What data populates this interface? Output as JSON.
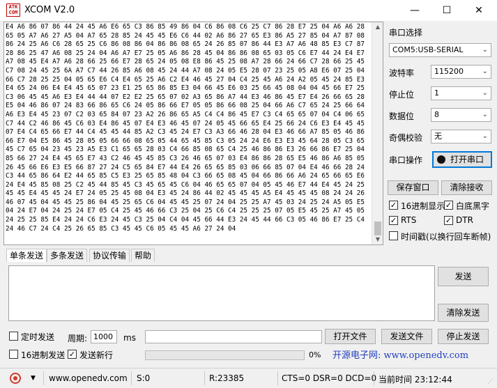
{
  "window": {
    "logo_text": "ATK COM",
    "title": "XCOM V2.0",
    "minimize": "—",
    "maximize": "☐",
    "close": "✕"
  },
  "receive": {
    "text": "E4 A6 86 07 86 44 24 45 A6 E6 65 C3 86 85 49 86 04 C6 86 08 C6 25 C7 86 28 E7 25 04 A6 A6 28 65 05 A7 A6 27 A5 04 A7 65 28 85 24 45 45 E6 C6 44 02 A6 86 27 65 E3 86 A5 27 85 04 A7 87 08 86 24 25 A6 C6 28 65 25 C6 86 08 86 04 86 86 08 65 24 26 85 07 86 44 E3 A7 A6 48 85 E3 C7 87 28 86 25 47 A6 08 25 24 04 A6 A7 E7 25 05 A6 86 28 45 04 86 86 08 65 03 05 C6 E7 44 24 E4 E7 A7 08 45 E4 A7 A6 28 66 25 66 E7 28 65 24 05 08 E8 86 45 25 08 A7 28 66 24 66 C7 28 66 25 45 C7 08 24 45 25 6A A7 C7 44 26 85 A6 08 45 24 44 A7 08 24 05 E5 28 07 23 25 05 A8 E6 07 25 04 66 C7 28 25 25 04 05 65 E6 C4 E4 65 25 A6 C2 E4 46 45 27 04 C4 25 45 A6 24 A2 05 45 24 85 E3 E4 65 24 06 E4 E4 45 65 07 23 E1 25 65 86 85 E3 04 66 45 E6 03 25 66 45 08 04 04 45 66 E7 25 C3 06 45 45 A6 E3 E4 44 44 07 E2 E2 25 65 07 02 A3 65 86 A7 44 E3 46 86 45 E7 E4 26 66 65 28 E5 04 46 86 07 24 83 66 86 65 C6 24 05 86 66 E7 05 05 86 66 08 25 04 66 A6 C7 65 24 25 66 64 A6 E3 E4 45 23 07 C2 03 65 84 07 23 A2 26 86 65 A5 C4 C4 86 45 E7 C3 C4 65 65 07 04 C4 06 65 C7 44 C2 46 86 45 C6 03 E4 86 45 07 E4 E3 46 45 07 24 05 45 66 65 E4 25 66 24 C6 E3 E4 45 45 07 E4 C4 65 66 E7 44 C4 45 45 44 85 A2 C3 45 24 E7 C3 A3 66 46 28 04 E3 46 66 A7 85 05 46 86 66 E7 04 E5 86 45 28 05 05 66 66 08 65 05 44 65 45 85 C3 05 24 24 E6 E3 E3 45 64 28 05 C3 65 45 C7 65 04 23 45 23 A5 E3 C1 65 65 28 03 C4 66 85 08 65 C4 25 46 86 86 E3 26 66 86 E7 25 04 85 66 27 24 E4 45 65 E7 43 C2 46 45 45 85 C3 26 46 65 07 03 E4 86 86 28 65 E5 46 86 A6 85 05 26 45 66 E6 E3 E5 66 87 27 24 C5 65 84 E7 44 E4 26 65 65 85 03 06 66 85 07 04 E4 46 66 28 24 C3 44 65 86 64 E2 44 65 85 C5 E3 25 65 85 48 04 C3 66 65 08 45 04 66 86 66 A6 24 65 66 65 E6 24 E4 45 85 08 25 C2 45 44 85 45 C3 45 65 45 C6 04 46 65 65 07 04 05 45 46 E7 44 E4 45 24 25 45 45 E4 45 45 24 E7 24 05 25 45 08 04 E3 45 24 86 44 02 45 45 45 A5 E4 45 45 45 08 24 24 26 46 07 45 04 45 45 25 86 04 45 25 65 C6 04 45 45 25 07 24 04 25 25 A7 45 03 24 25 24 A5 05 E5 04 24 E7 04 24 25 24 E7 05 C4 25 45 46 66 C3 25 04 25 C6 C4 25 25 25 07 05 E5 45 25 A7 45 05 24 25 25 85 E4 24 24 C6 E3 24 45 C3 25 04 C4 04 45 66 44 E3 24 45 44 66 C3 05 46 86 E7 25 C4 24 46 C7 24 C4 25 26 65 85 C3 45 45 C6 05 45 45 A6 27 24 04"
  },
  "panel": {
    "port_select_label": "串口选择",
    "port_value": "COM5:USB-SERIAL",
    "baud_label": "波特率",
    "baud_value": "115200",
    "stop_label": "停止位",
    "stop_value": "1",
    "data_label": "数据位",
    "data_value": "8",
    "parity_label": "奇偶校验",
    "parity_value": "无",
    "op_label": "串口操作",
    "open_button": "打开串口",
    "save_window": "保存窗口",
    "clear_recv": "清除接收",
    "hex_display": "16进制显示",
    "white_black": "白底黑字",
    "rts": "RTS",
    "dtr": "DTR",
    "timestamp": "时间戳(以换行回车断帧)"
  },
  "tabs": [
    "单条发送",
    "多条发送",
    "协议传输",
    "帮助"
  ],
  "send": {
    "send_button": "发送",
    "clear_send": "清除发送",
    "timed_send": "定时发送",
    "period_label": "周期:",
    "period_value": "1000",
    "period_unit": "ms",
    "open_file": "打开文件",
    "send_file": "发送文件",
    "stop_send": "停止发送",
    "hex_send": "16进制发送",
    "send_newline": "发送新行",
    "progress": "0%",
    "website_banner": "开源电子网: www.openedv.com"
  },
  "status": {
    "url": "www.openedv.com",
    "s": "S:0",
    "r": "R:23385",
    "lines": "CTS=0 DSR=0 DCD=0",
    "time": "当前时间 23:12:44"
  },
  "colors": {
    "banner_text": "#1f3fbf",
    "accent": "#0078d7"
  }
}
